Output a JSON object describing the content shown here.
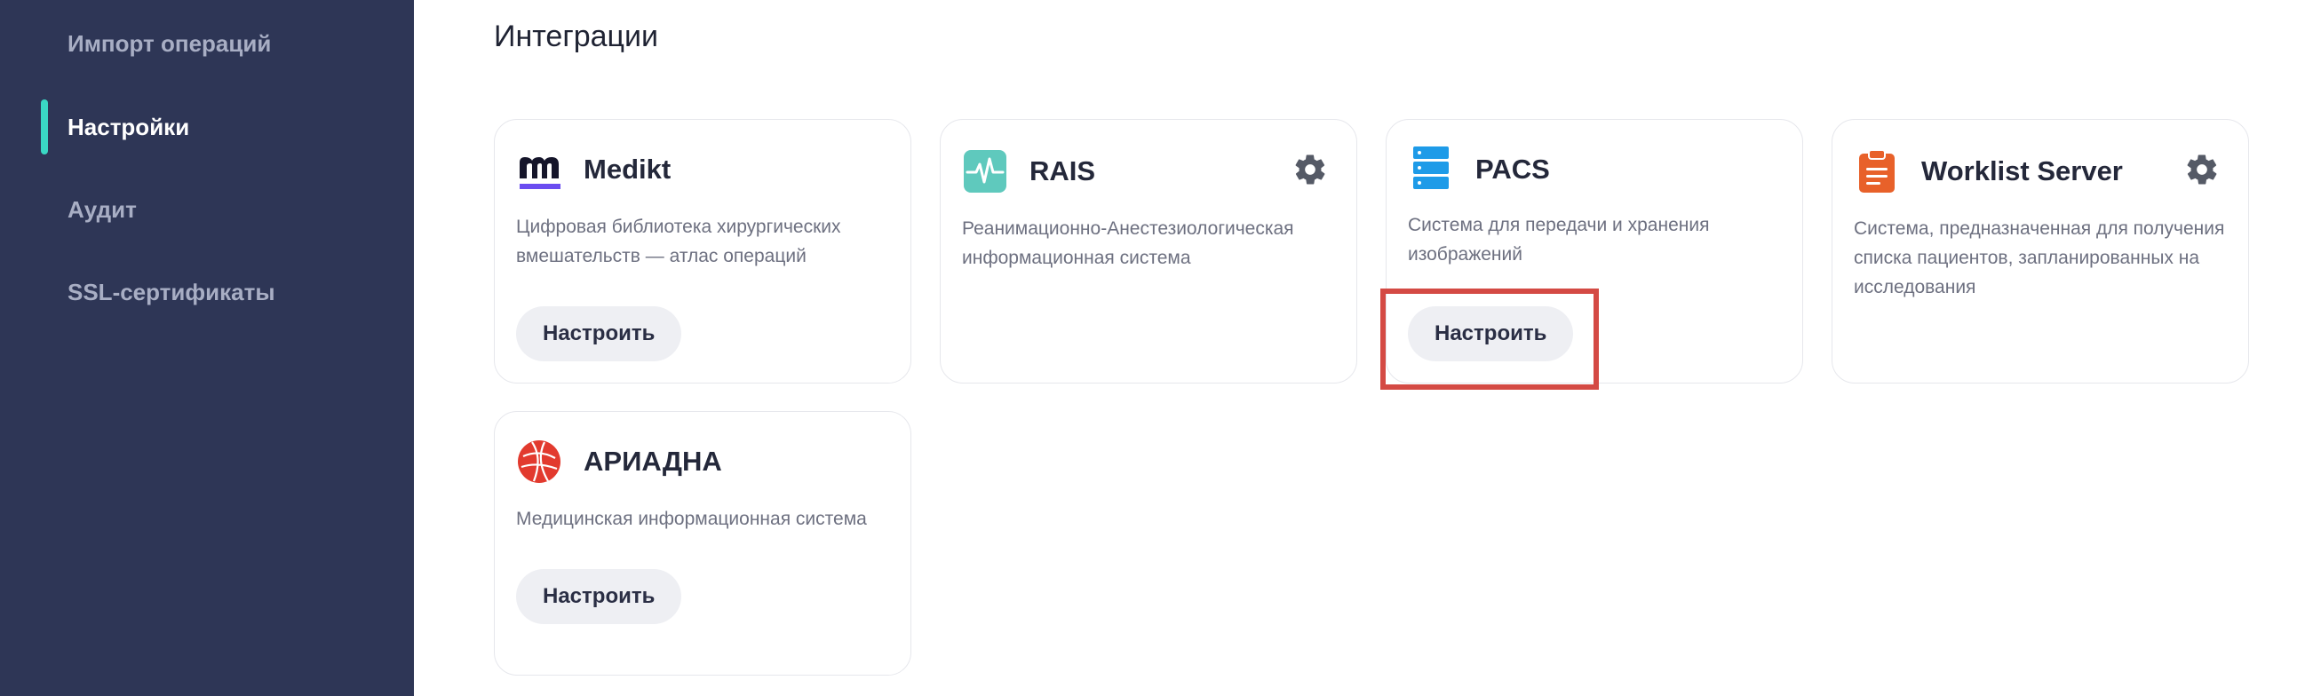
{
  "sidebar": {
    "items": [
      {
        "label": "Импорт операций",
        "active": false
      },
      {
        "label": "Настройки",
        "active": true
      },
      {
        "label": "Аудит",
        "active": false
      },
      {
        "label": "SSL-сертификаты",
        "active": false
      }
    ],
    "background": "#2e3656",
    "indicator_color": "#3ad8c4"
  },
  "main": {
    "title": "Интеграции",
    "cards": [
      {
        "title": "Medikt",
        "description": "Цифровая библиотека хирургических вмешательств — атлас операций",
        "button": "Настроить",
        "icon": "medikt-logo-icon",
        "has_settings": false
      },
      {
        "title": "RAIS",
        "description": "Реанимационно-Анестезиологическая информационная система",
        "button": "",
        "icon": "heart-monitor-icon",
        "has_settings": true
      },
      {
        "title": "PACS",
        "description": "Система для передачи и хранения изображений",
        "button": "Настроить",
        "icon": "server-stack-icon",
        "has_settings": false
      },
      {
        "title": "Worklist Server",
        "description": "Система, предназначенная для получения списка пациентов, запланированных на исследования",
        "button": "",
        "icon": "clipboard-list-icon",
        "has_settings": true
      },
      {
        "title": "АРИАДНА",
        "description": "Медицинская информационная система",
        "button": "Настроить",
        "icon": "ariadna-globe-icon",
        "has_settings": false
      }
    ]
  },
  "colors": {
    "accent_teal": "#3ad8c4",
    "pacs_blue": "#1e9be8",
    "worklist_orange": "#e8612a",
    "ariadna_red": "#e23a2e",
    "medikt_purple": "#6a4cf0",
    "highlight_red": "#d44a44"
  }
}
